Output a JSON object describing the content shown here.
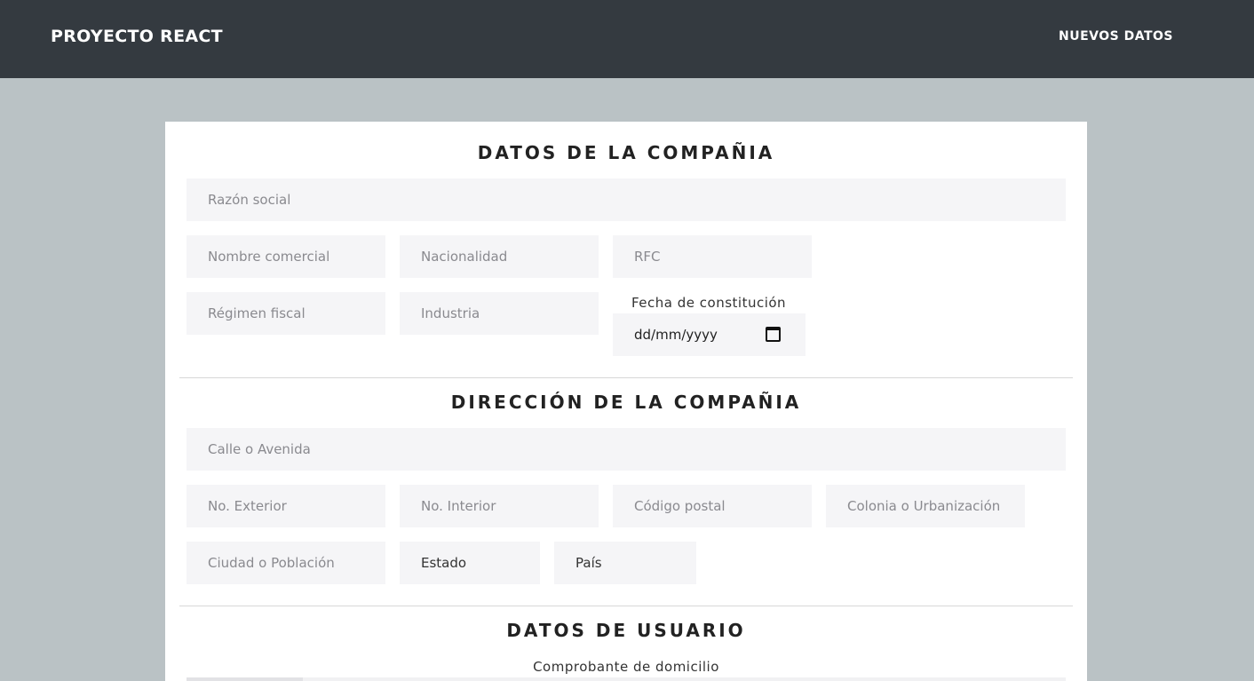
{
  "navbar": {
    "brand": "PROYECTO REACT",
    "link": "NUEVOS DATOS"
  },
  "company": {
    "title": "DATOS DE LA COMPAÑIA",
    "razon_social": "Razón social",
    "nombre_comercial": "Nombre comercial",
    "nacionalidad": "Nacionalidad",
    "rfc": "RFC",
    "regimen_fiscal": "Régimen fiscal",
    "industria": "Industria",
    "fecha_label": "Fecha de constitución",
    "fecha_value": "dd/mm/yyyy"
  },
  "address": {
    "title": "DIRECCIÓN DE LA COMPAÑIA",
    "calle": "Calle o Avenida",
    "no_exterior": "No. Exterior",
    "no_interior": "No. Interior",
    "codigo_postal": "Código postal",
    "colonia": "Colonia o Urbanización",
    "ciudad": "Ciudad o Población",
    "estado": "Estado",
    "pais": "País"
  },
  "user": {
    "title": "DATOS DE USUARIO",
    "comprobante_label": "Comprobante de domicilio"
  }
}
